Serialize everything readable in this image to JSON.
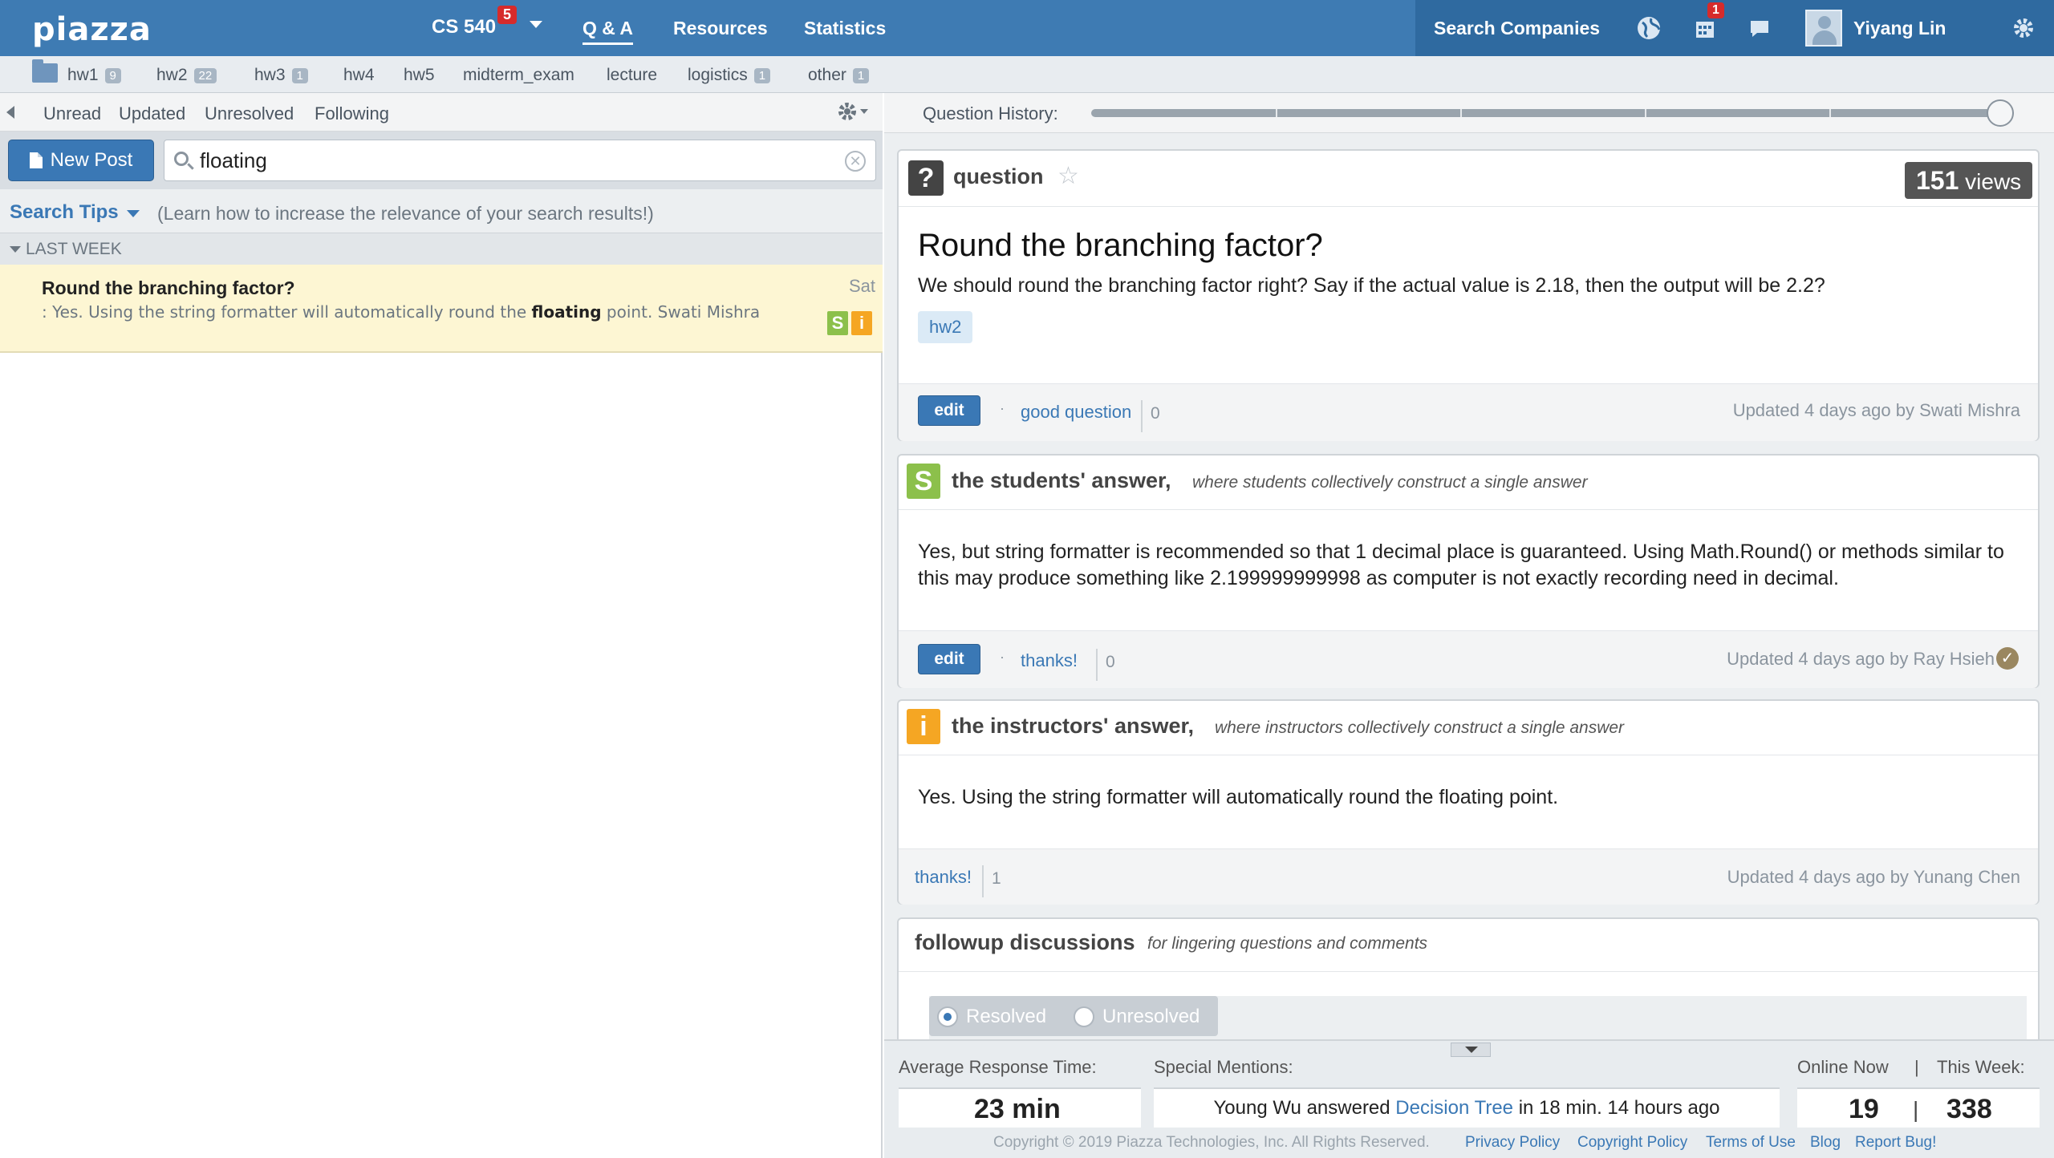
{
  "topbar": {
    "logo": "piazza",
    "course": "CS 540",
    "course_badge": "5",
    "nav": [
      "Q & A",
      "Resources",
      "Statistics"
    ],
    "search_companies": "Search Companies",
    "calendar_badge": "1",
    "user": "Yiyang Lin",
    "icons": [
      "globe-icon",
      "calendar-icon",
      "chat-icon",
      "avatar",
      "gear-icon"
    ]
  },
  "folders": [
    {
      "name": "hw1",
      "count": "9"
    },
    {
      "name": "hw2",
      "count": "22"
    },
    {
      "name": "hw3",
      "count": "1"
    },
    {
      "name": "hw4",
      "count": ""
    },
    {
      "name": "hw5",
      "count": ""
    },
    {
      "name": "midterm_exam",
      "count": ""
    },
    {
      "name": "lecture",
      "count": ""
    },
    {
      "name": "logistics",
      "count": "1"
    },
    {
      "name": "other",
      "count": "1"
    }
  ],
  "filters": [
    "Unread",
    "Updated",
    "Unresolved",
    "Following"
  ],
  "search": {
    "new_post": "New Post",
    "query": "floating",
    "tips_label": "Search Tips",
    "tips_text": "(Learn how to increase the relevance of your search results!)"
  },
  "feed": {
    "group": "LAST WEEK",
    "post": {
      "title": "Round the branching factor?",
      "day": "Sat",
      "snippet_before": ": Yes. Using the string formatter will automatically round the ",
      "snippet_highlight": "floating",
      "snippet_after": " point. Swati Mishra",
      "badges": [
        "S",
        "i"
      ]
    }
  },
  "history": {
    "label": "Question History:",
    "position": 1.0
  },
  "question": {
    "type": "question",
    "views_count": "151",
    "views_label": "views",
    "title": "Round the branching factor?",
    "body": "We should round the branching factor right? Say if the actual value is 2.18, then the output will be 2.2?",
    "tag": "hw2",
    "edit": "edit",
    "good_question": "good question",
    "good_count": "0",
    "updated": "Updated 4 days ago by Swati Mishra"
  },
  "students_answer": {
    "badge": "S",
    "title": "the students' answer,",
    "desc": "where students collectively construct a single answer",
    "body": "Yes, but string formatter is recommended so that 1 decimal place is guaranteed. Using Math.Round() or methods similar to this may produce something like 2.199999999998 as computer is not exactly recording need in decimal.",
    "edit": "edit",
    "thanks": "thanks!",
    "thanks_count": "0",
    "updated": "Updated 4 days ago by Ray Hsieh"
  },
  "instructors_answer": {
    "badge": "i",
    "title": "the instructors' answer,",
    "desc": "where instructors collectively construct a single answer",
    "body": "Yes. Using the string formatter will automatically round the floating point.",
    "thanks": "thanks!",
    "thanks_count": "1",
    "updated": "Updated 4 days ago by Yunang Chen"
  },
  "followup": {
    "title": "followup discussions",
    "desc": "for lingering questions and comments",
    "resolved": "Resolved",
    "unresolved": "Unresolved"
  },
  "stats": {
    "avg_label": "Average Response Time:",
    "avg_value": "23 min",
    "mentions_label": "Special Mentions:",
    "mention_before": "Young Wu answered ",
    "mention_link": "Decision Tree",
    "mention_after": " in 18 min. 14 hours ago",
    "online_label": "Online Now",
    "week_label": "This Week:",
    "online_value": "19",
    "week_value": "338",
    "sep": "|"
  },
  "footer": {
    "copyright": "Copyright © 2019 Piazza Technologies, Inc. All Rights Reserved.",
    "links": [
      "Privacy Policy",
      "Copyright Policy",
      "Terms of Use",
      "Blog",
      "Report Bug!"
    ]
  },
  "colors": {
    "topbar": "#3e7bb3",
    "accent": "#3a78b5",
    "students_badge": "#8cc04b",
    "instructors_badge": "#f5a623",
    "highlight_row": "#fdf6d3",
    "notification": "#d62b2b"
  }
}
